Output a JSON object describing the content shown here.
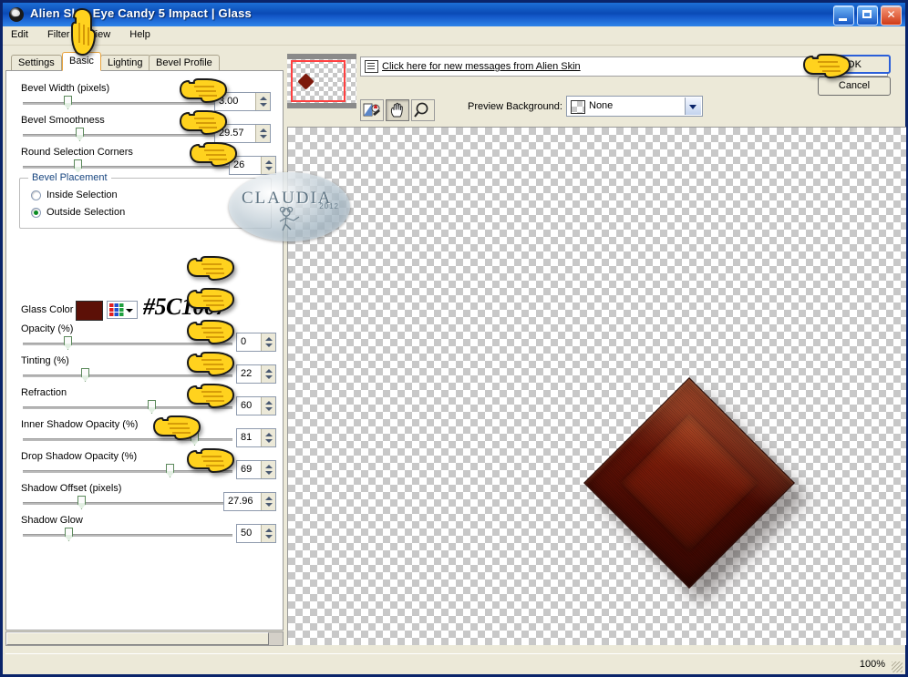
{
  "window": {
    "title": "Alien Skin  Eye Candy 5 Impact  |  Glass",
    "icon": "alien-head-icon",
    "minimize": "_",
    "maximize": "□",
    "close": "✕"
  },
  "menu": {
    "items": [
      "Edit",
      "Filter",
      "View",
      "Help"
    ]
  },
  "tabs": [
    {
      "label": "Settings",
      "active": false
    },
    {
      "label": "Basic",
      "active": true
    },
    {
      "label": "Lighting",
      "active": false
    },
    {
      "label": "Bevel Profile",
      "active": false
    }
  ],
  "sliders": [
    {
      "label": "Bevel Width (pixels)",
      "value": "3.00",
      "thumb_pct": 0
    },
    {
      "label": "Bevel Smoothness",
      "value": "29.57",
      "thumb_pct": 30
    },
    {
      "label": "Round Selection Corners",
      "value": "26",
      "thumb_pct": 26
    }
  ],
  "bevel_placement": {
    "title": "Bevel Placement",
    "options": [
      {
        "label": "Inside Selection",
        "selected": false
      },
      {
        "label": "Outside Selection",
        "selected": true
      }
    ]
  },
  "glass_color": {
    "label": "Glass Color",
    "swatch_hex": "#5C1007",
    "annotation": "#5C1007",
    "palette_icon": "color-grid-icon",
    "dropdown_icon": "chevron-down-icon"
  },
  "sliders2": [
    {
      "label": "Opacity (%)",
      "value": "0",
      "thumb_pct": 0
    },
    {
      "label": "Tinting (%)",
      "value": "22",
      "thumb_pct": 22
    },
    {
      "label": "Refraction",
      "value": "60",
      "thumb_pct": 60
    },
    {
      "label": "Inner Shadow Opacity (%)",
      "value": "81",
      "thumb_pct": 81
    },
    {
      "label": "Drop Shadow Opacity (%)",
      "value": "69",
      "thumb_pct": 69
    },
    {
      "label": "Shadow Offset (pixels)",
      "value": "27.96",
      "thumb_pct": 28
    },
    {
      "label": "Shadow Glow",
      "value": "50",
      "thumb_pct": 22
    }
  ],
  "message_bar": {
    "icon": "message-icon",
    "link_text": "Click here for new messages from Alien Skin"
  },
  "preview_tools": [
    {
      "name": "color-compare-icon",
      "pressed": false
    },
    {
      "name": "hand-pan-icon",
      "pressed": true
    },
    {
      "name": "magnifier-zoom-icon",
      "pressed": false
    }
  ],
  "preview_background": {
    "label": "Preview Background:",
    "value": "None",
    "swatch": "checkerboard"
  },
  "buttons": {
    "ok": "OK",
    "cancel": "Cancel"
  },
  "watermark": {
    "text": "CLAUDIA",
    "year": "2012"
  },
  "status": {
    "zoom": "100%"
  }
}
